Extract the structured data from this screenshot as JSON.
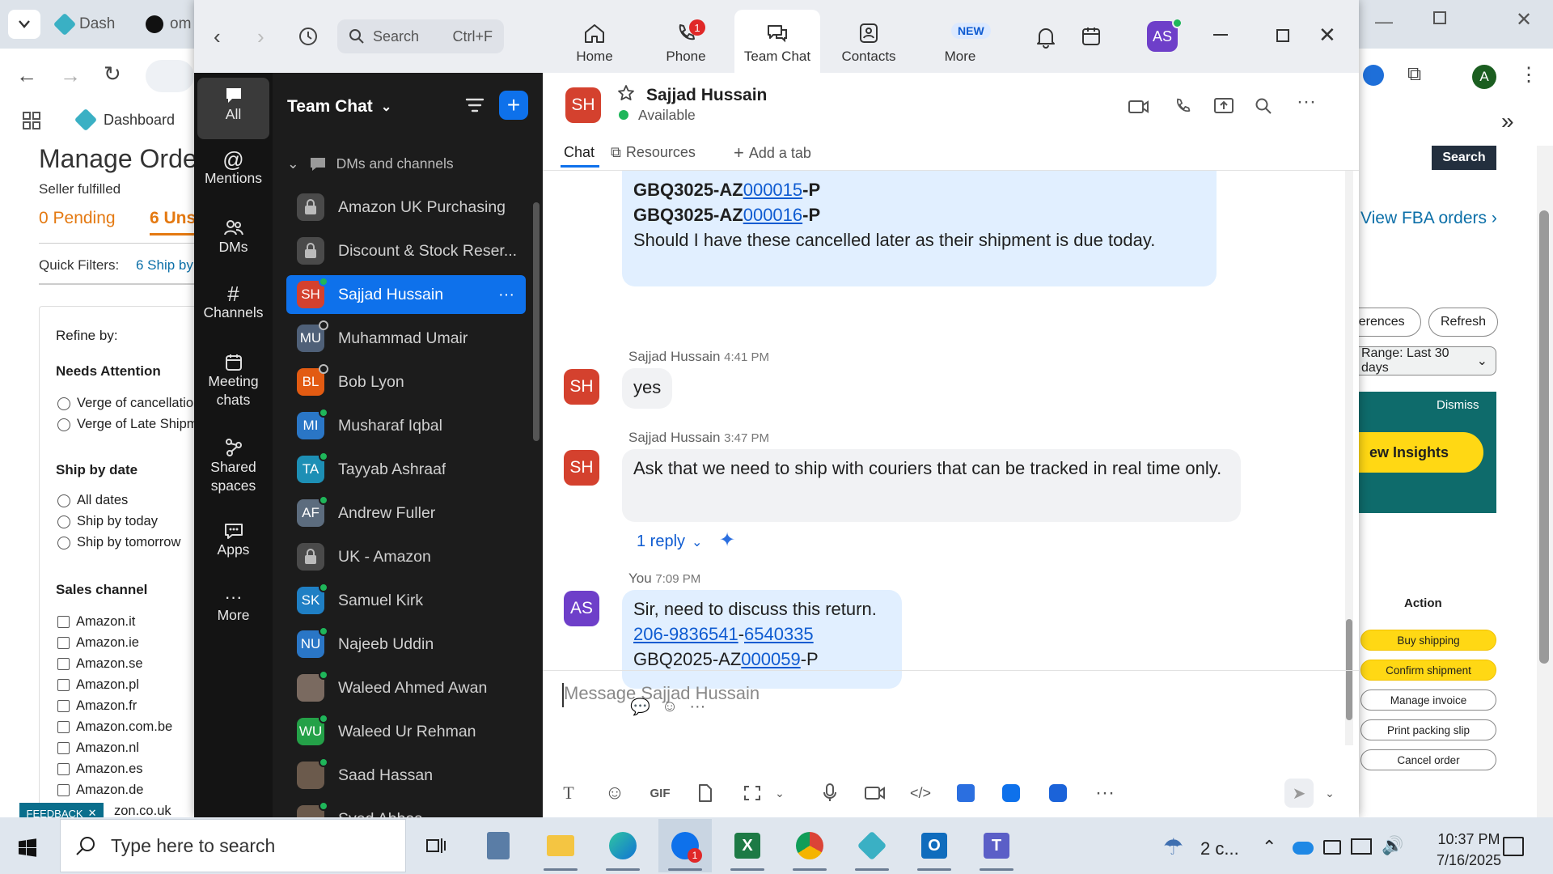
{
  "browser": {
    "tabs": [
      {
        "label": "Dash"
      },
      {
        "label": "om"
      }
    ],
    "bookmark": "Dashboard"
  },
  "amazon": {
    "page_title": "Manage Orde",
    "seller_fulfilled": "Seller fulfilled",
    "pending": "0 Pending",
    "unshipped": "6 Uns",
    "quick_filters_label": "Quick Filters:",
    "quick_filter_ship": "6 Ship by",
    "refine": {
      "title": "Refine by:",
      "needs_attention": "Needs Attention",
      "na_options": [
        "Verge of cancellatio",
        "Verge of Late Shipm"
      ],
      "ship_by_date": "Ship by date",
      "sbd_options": [
        "All dates",
        "Ship by today",
        "Ship by tomorrow"
      ],
      "sales_channel": "Sales channel",
      "channels": [
        "Amazon.it",
        "Amazon.ie",
        "Amazon.se",
        "Amazon.pl",
        "Amazon.fr",
        "Amazon.com.be",
        "Amazon.nl",
        "Amazon.es",
        "Amazon.de",
        "zon.co.uk"
      ]
    },
    "feedback": "FEEDBACK",
    "search_btn": "Search",
    "view_fba": "View FBA orders",
    "preferences": "ferences",
    "refresh": "Refresh",
    "range": "Range: Last 30 days",
    "dismiss": "Dismiss",
    "insights": "ew Insights",
    "action_header": "Action",
    "actions": [
      "Buy shipping",
      "Confirm shipment",
      "Manage invoice",
      "Print packing slip",
      "Cancel order"
    ]
  },
  "zoom": {
    "search_placeholder": "Search",
    "search_shortcut": "Ctrl+F",
    "nav": [
      {
        "label": "Home"
      },
      {
        "label": "Phone",
        "badge": "1"
      },
      {
        "label": "Team Chat"
      },
      {
        "label": "Contacts"
      },
      {
        "label": "More",
        "badge": "NEW"
      }
    ],
    "user_initials": "AS",
    "rail": [
      {
        "label": "All"
      },
      {
        "label": "Mentions"
      },
      {
        "label": "DMs"
      },
      {
        "label": "Channels"
      },
      {
        "label": "Meeting chats"
      },
      {
        "label": "Shared spaces"
      },
      {
        "label": "Apps"
      },
      {
        "label": "More"
      }
    ],
    "panel_title": "Team Chat",
    "section_label": "DMs and channels",
    "channels": [
      {
        "name": "Amazon UK Purchasing",
        "initials": "",
        "color": "#4a4a4a",
        "status": "lock"
      },
      {
        "name": "Discount & Stock Reser...",
        "initials": "",
        "color": "#4a4a4a",
        "status": "lock"
      },
      {
        "name": "Sajjad Hussain",
        "initials": "SH",
        "color": "#d4412e",
        "status": "online"
      },
      {
        "name": "Muhammad Umair",
        "initials": "MU",
        "color": "#4f6078",
        "status": "offline"
      },
      {
        "name": "Bob Lyon",
        "initials": "BL",
        "color": "#e25b12",
        "status": "offline"
      },
      {
        "name": "Musharaf Iqbal",
        "initials": "MI",
        "color": "#2a76c6",
        "status": "online"
      },
      {
        "name": "Tayyab Ashraaf",
        "initials": "TA",
        "color": "#1d8fb5",
        "status": "online"
      },
      {
        "name": "Andrew Fuller",
        "initials": "AF",
        "color": "#5c6c7e",
        "status": "online"
      },
      {
        "name": "UK - Amazon",
        "initials": "",
        "color": "#4a4a4a",
        "status": "lock"
      },
      {
        "name": "Samuel Kirk",
        "initials": "SK",
        "color": "#1f7fc4",
        "status": "online"
      },
      {
        "name": "Najeeb Uddin",
        "initials": "NU",
        "color": "#2a76c6",
        "status": "online"
      },
      {
        "name": "Waleed Ahmed Awan",
        "initials": "",
        "color": "#7a6a60",
        "status": "online"
      },
      {
        "name": "Waleed Ur Rehman",
        "initials": "WU",
        "color": "#24a148",
        "status": "online"
      },
      {
        "name": "Saad Hassan",
        "initials": "",
        "color": "#6b5a4c",
        "status": "online"
      },
      {
        "name": "Syed Abbas",
        "initials": "",
        "color": "#6b5a4c",
        "status": "online"
      }
    ],
    "chat": {
      "contact_initials": "SH",
      "contact_name": "Sajjad Hussain",
      "contact_status": "Available",
      "tabs": [
        "Chat",
        "Resources",
        "Add a tab"
      ],
      "prev_lines": [
        {
          "prefix": "GBQ3025-AZ",
          "link": "000015",
          "suffix": "-P"
        },
        {
          "prefix": "GBQ3025-AZ",
          "link": "000016",
          "suffix": "-P"
        }
      ],
      "prev_text": "Should I have these cancelled later as their shipment is due today.",
      "messages": [
        {
          "sender": "Sajjad Hussain",
          "time": "4:41 PM",
          "text": "yes"
        },
        {
          "sender": "Sajjad Hussain",
          "time": "3:47 PM",
          "text": "Ask that we need to ship with couriers that can be tracked in real time only.",
          "reply": "1 reply"
        },
        {
          "sender": "You",
          "time": "7:09 PM",
          "initials": "AS",
          "line1": "Sir, need to discuss this return.",
          "link_a": "206-9836541",
          "sep": "-",
          "link_b": "6540335",
          "l3_prefix": "GBQ2025-AZ",
          "l3_link": "000059",
          "l3_suffix": "-P"
        }
      ],
      "composer_placeholder": "Message Sajjad Hussain"
    }
  },
  "taskbar": {
    "search_placeholder": "Type here to search",
    "weather": "2 c...",
    "time": "10:37 PM",
    "date": "7/16/2025",
    "zoom_badge": "1"
  },
  "colors": {
    "zoom_blue": "#0e71eb",
    "online": "#1fb65a",
    "avatar_sh": "#d4412e",
    "avatar_as": "#6e3fc9",
    "amazon_yellow": "#ffd814"
  }
}
